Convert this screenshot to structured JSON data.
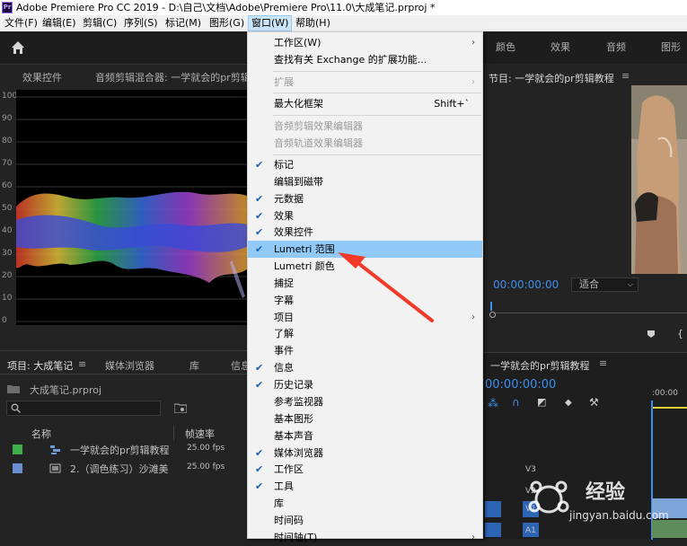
{
  "window": {
    "title": "Adobe Premiere Pro CC 2019 - D:\\自己\\文档\\Adobe\\Premiere Pro\\11.0\\大成笔记.prproj *",
    "app_icon": "Pr"
  },
  "menubar": [
    "文件(F)",
    "编辑(E)",
    "剪辑(C)",
    "序列(S)",
    "标记(M)",
    "图形(G)",
    "窗口(W)",
    "帮助(H)"
  ],
  "workspace_tabs": [
    "颜色",
    "效果",
    "音频",
    "图形"
  ],
  "left_panel": {
    "tabs": [
      "效果控件",
      "音频剪辑混合器: 一学就会的pr剪辑"
    ],
    "scope_y_labels": [
      "100",
      "90",
      "80",
      "70",
      "60",
      "50",
      "40",
      "30",
      "20",
      "10",
      "0"
    ]
  },
  "project_panel": {
    "tabs": [
      "项目: 大成笔记",
      "媒体浏览器",
      "库",
      "信息"
    ],
    "file": "大成笔记.prproj",
    "columns": [
      "名称",
      "帧速率"
    ],
    "items": [
      {
        "name": "一学就会的pr剪辑教程",
        "rate": "25.00 fps",
        "color": "#3fae49"
      },
      {
        "name": "2.（调色练习）沙滩美",
        "rate": "25.00 fps",
        "color": "#6e8fcf"
      }
    ]
  },
  "program_monitor": {
    "title": "节目: 一学就会的pr剪辑教程",
    "timecode": "00:00:00:00",
    "fit": "适合"
  },
  "timeline": {
    "title": "一学就会的pr剪辑教程",
    "timecode": "00:00:00:00",
    "ruler": ":00:00",
    "tracks": [
      "V3",
      "V2",
      "V1",
      "A1"
    ]
  },
  "window_menu": {
    "items": [
      {
        "label": "工作区(W)",
        "submenu": true
      },
      {
        "label": "查找有关 Exchange 的扩展功能..."
      },
      {
        "sep": true
      },
      {
        "label": "扩展",
        "submenu": true,
        "disabled": true
      },
      {
        "sep": true
      },
      {
        "label": "最大化框架",
        "accel": "Shift+`"
      },
      {
        "sep": true
      },
      {
        "label": "音频剪辑效果编辑器",
        "disabled": true
      },
      {
        "label": "音频轨道效果编辑器",
        "disabled": true
      },
      {
        "sep": true
      },
      {
        "label": "标记",
        "checked": true
      },
      {
        "label": "编辑到磁带"
      },
      {
        "label": "元数据",
        "checked": true
      },
      {
        "label": "效果",
        "checked": true
      },
      {
        "label": "效果控件",
        "checked": true
      },
      {
        "label": "Lumetri 范围",
        "checked": true,
        "highlighted": true
      },
      {
        "label": "Lumetri 颜色"
      },
      {
        "label": "捕捉"
      },
      {
        "label": "字幕"
      },
      {
        "label": "项目",
        "submenu": true
      },
      {
        "label": "了解"
      },
      {
        "label": "事件"
      },
      {
        "label": "信息",
        "checked": true
      },
      {
        "label": "历史记录",
        "checked": true
      },
      {
        "label": "参考监视器"
      },
      {
        "label": "基本图形"
      },
      {
        "label": "基本声音"
      },
      {
        "label": "媒体浏览器",
        "checked": true
      },
      {
        "label": "工作区",
        "checked": true
      },
      {
        "label": "工具",
        "checked": true
      },
      {
        "label": "库"
      },
      {
        "label": "时间码"
      },
      {
        "label": "时间轴(T)",
        "submenu": true
      }
    ]
  },
  "watermark": {
    "brand": "经验",
    "url": "jingyan.baidu.com"
  },
  "colors": {
    "accent": "#1a5fb4",
    "highlight": "#91c9f7",
    "timecode_blue": "#3d8ff0",
    "arrow_red": "#f23a2a"
  }
}
